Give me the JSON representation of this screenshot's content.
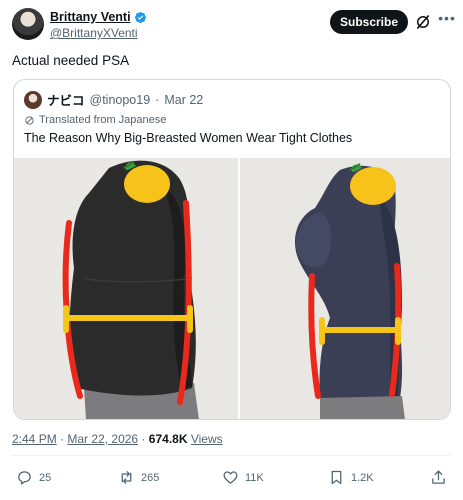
{
  "author": {
    "name": "Brittany Venti",
    "handle": "@BrittanyXVenti",
    "subscribe_label": "Subscribe"
  },
  "tweet": {
    "text": "Actual needed PSA"
  },
  "quote": {
    "name": "ナビコ",
    "handle": "@tinopo19",
    "separator": "·",
    "date": "Mar 22",
    "translated_label": "Translated from Japanese",
    "text": "The Reason Why Big-Breasted Women Wear Tight Clothes"
  },
  "meta": {
    "time": "2:44 PM",
    "separator": "·",
    "date": "Mar 22, 2026",
    "separator2": "·",
    "views_count": "674.8K",
    "views_label": "Views"
  },
  "actions": {
    "replies": "25",
    "reposts": "265",
    "likes": "11K",
    "bookmarks": "1.2K"
  },
  "colors": {
    "accent": "#1d9bf0",
    "text": "#0f1419",
    "muted": "#536471",
    "border": "#cfd9de",
    "marker_red": "#e8291c",
    "marker_yellow": "#f5c518"
  },
  "icons": [
    "verified-badge-icon",
    "grok-icon",
    "more-icon",
    "translate-icon",
    "reply-icon",
    "repost-icon",
    "like-icon",
    "bookmark-icon",
    "share-icon"
  ]
}
